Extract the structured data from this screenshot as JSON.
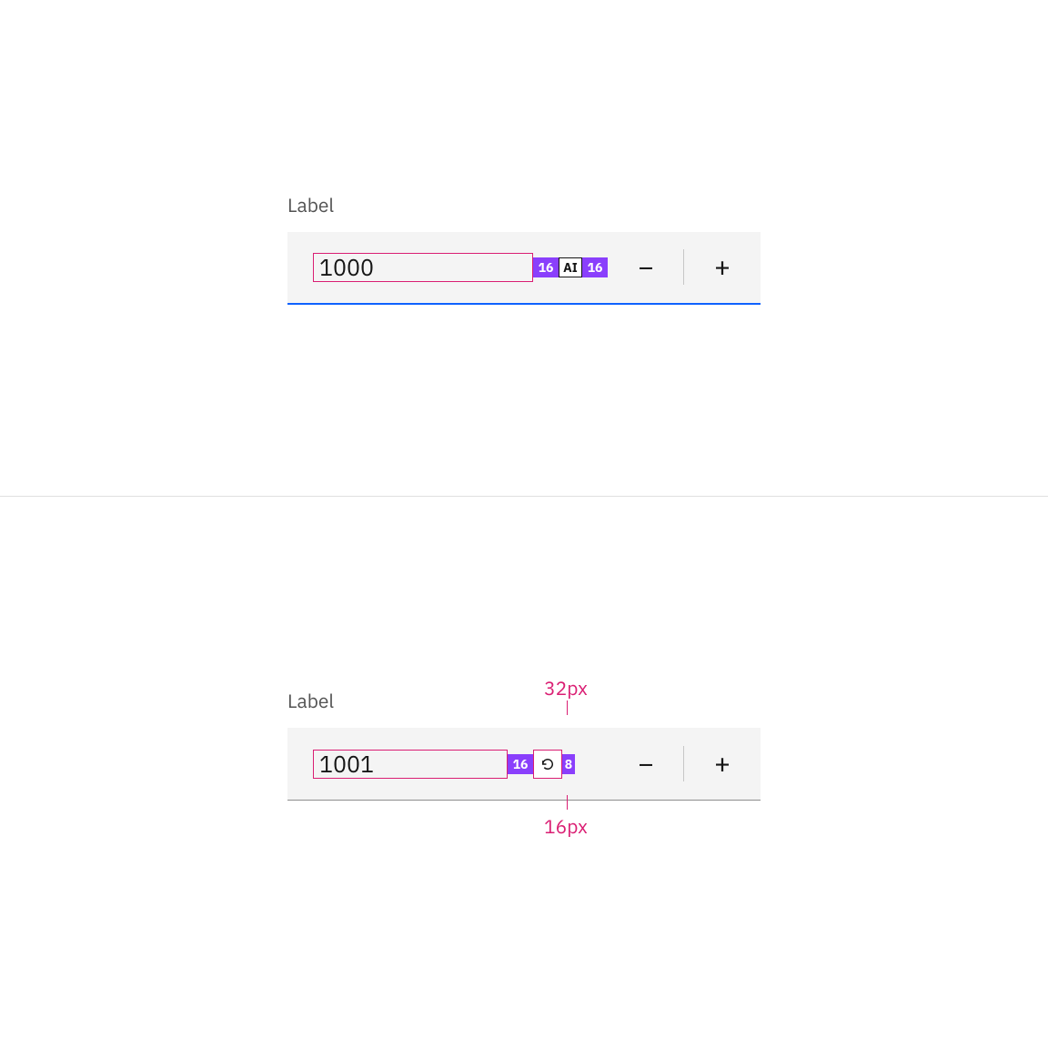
{
  "example1": {
    "label": "Label",
    "value": "1000",
    "spacingLeft": "16",
    "slug": "AI",
    "spacingRight": "16"
  },
  "example2": {
    "label": "Label",
    "value": "1001",
    "spacingLeft": "16",
    "spacingRight": "8",
    "calloutTop": "32px",
    "calloutBottom": "16px"
  },
  "icons": {
    "minus": "−",
    "plus": "+"
  }
}
